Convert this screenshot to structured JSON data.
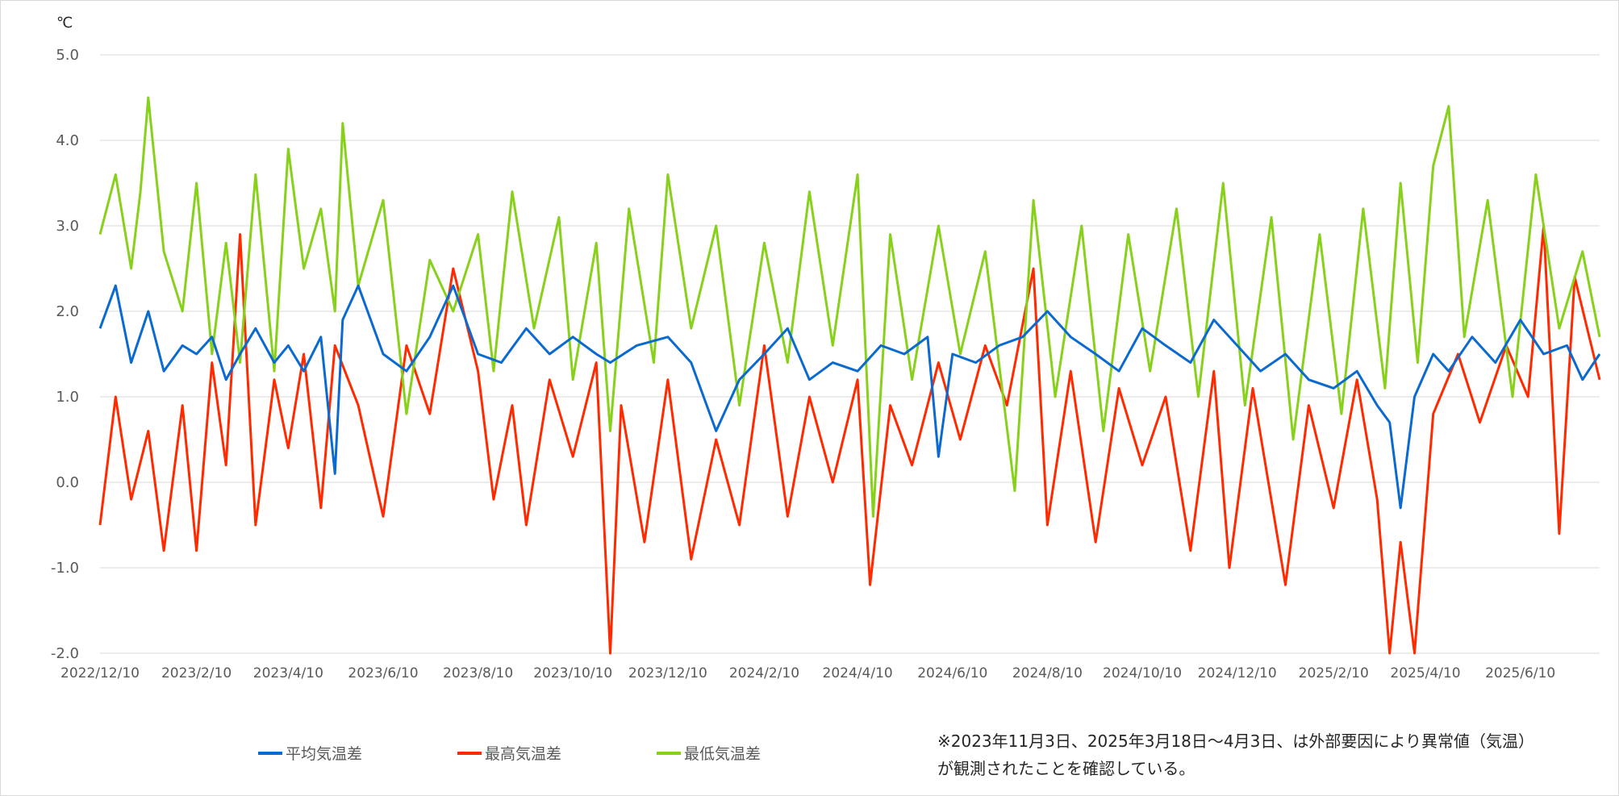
{
  "chart_data": {
    "type": "line",
    "title": "",
    "ylabel": "℃",
    "xlabel": "",
    "ylim": [
      -2.0,
      5.0
    ],
    "yticks": [
      "5.0",
      "4.0",
      "3.0",
      "2.0",
      "1.0",
      "0.0",
      "-1.0",
      "-2.0"
    ],
    "x_start": "2022/12/10",
    "x_end": "2025/7/31",
    "xticks": [
      "2022/12/10",
      "2023/2/10",
      "2023/4/10",
      "2023/6/10",
      "2023/8/10",
      "2023/10/10",
      "2023/12/10",
      "2024/2/10",
      "2024/4/10",
      "2024/6/10",
      "2024/8/10",
      "2024/10/10",
      "2024/12/10",
      "2025/2/10",
      "2025/4/10",
      "2025/6/10"
    ],
    "grid": true,
    "legend_position": "bottom",
    "colors": {
      "avg": "#0a6ad0",
      "max": "#ff2a00",
      "min": "#88d11a",
      "grid": "#d9d9d9"
    },
    "series": [
      {
        "key": "avg",
        "name": "平均気温差",
        "color": "#0a6ad0",
        "points": [
          [
            "2022/12/10",
            1.8
          ],
          [
            "2022/12/20",
            2.3
          ],
          [
            "2022/12/30",
            1.4
          ],
          [
            "2023/1/10",
            2.0
          ],
          [
            "2023/1/20",
            1.3
          ],
          [
            "2023/2/1",
            1.6
          ],
          [
            "2023/2/10",
            1.5
          ],
          [
            "2023/2/20",
            1.7
          ],
          [
            "2023/3/1",
            1.2
          ],
          [
            "2023/3/10",
            1.5
          ],
          [
            "2023/3/20",
            1.8
          ],
          [
            "2023/4/1",
            1.4
          ],
          [
            "2023/4/10",
            1.6
          ],
          [
            "2023/4/20",
            1.3
          ],
          [
            "2023/5/1",
            1.7
          ],
          [
            "2023/5/10",
            0.1
          ],
          [
            "2023/5/15",
            1.9
          ],
          [
            "2023/5/25",
            2.3
          ],
          [
            "2023/6/10",
            1.5
          ],
          [
            "2023/6/25",
            1.3
          ],
          [
            "2023/7/10",
            1.7
          ],
          [
            "2023/7/25",
            2.3
          ],
          [
            "2023/8/10",
            1.5
          ],
          [
            "2023/8/25",
            1.4
          ],
          [
            "2023/9/10",
            1.8
          ],
          [
            "2023/9/25",
            1.5
          ],
          [
            "2023/10/10",
            1.7
          ],
          [
            "2023/10/25",
            1.5
          ],
          [
            "2023/11/3",
            1.4
          ],
          [
            "2023/11/20",
            1.6
          ],
          [
            "2023/12/10",
            1.7
          ],
          [
            "2023/12/25",
            1.4
          ],
          [
            "2024/1/10",
            0.6
          ],
          [
            "2024/1/25",
            1.2
          ],
          [
            "2024/2/10",
            1.5
          ],
          [
            "2024/2/25",
            1.8
          ],
          [
            "2024/3/10",
            1.2
          ],
          [
            "2024/3/25",
            1.4
          ],
          [
            "2024/4/10",
            1.3
          ],
          [
            "2024/4/25",
            1.6
          ],
          [
            "2024/5/10",
            1.5
          ],
          [
            "2024/5/25",
            1.7
          ],
          [
            "2024/6/1",
            0.3
          ],
          [
            "2024/6/10",
            1.5
          ],
          [
            "2024/6/25",
            1.4
          ],
          [
            "2024/7/10",
            1.6
          ],
          [
            "2024/7/25",
            1.7
          ],
          [
            "2024/8/10",
            2.0
          ],
          [
            "2024/8/25",
            1.7
          ],
          [
            "2024/9/10",
            1.5
          ],
          [
            "2024/9/25",
            1.3
          ],
          [
            "2024/10/10",
            1.8
          ],
          [
            "2024/10/25",
            1.6
          ],
          [
            "2024/11/10",
            1.4
          ],
          [
            "2024/11/25",
            1.9
          ],
          [
            "2024/12/10",
            1.6
          ],
          [
            "2024/12/25",
            1.3
          ],
          [
            "2025/1/10",
            1.5
          ],
          [
            "2025/1/25",
            1.2
          ],
          [
            "2025/2/10",
            1.1
          ],
          [
            "2025/2/25",
            1.3
          ],
          [
            "2025/3/10",
            0.9
          ],
          [
            "2025/3/18",
            0.7
          ],
          [
            "2025/3/25",
            -0.3
          ],
          [
            "2025/4/3",
            1.0
          ],
          [
            "2025/4/15",
            1.5
          ],
          [
            "2025/4/25",
            1.3
          ],
          [
            "2025/5/10",
            1.7
          ],
          [
            "2025/5/25",
            1.4
          ],
          [
            "2025/6/10",
            1.9
          ],
          [
            "2025/6/25",
            1.5
          ],
          [
            "2025/7/10",
            1.6
          ],
          [
            "2025/7/20",
            1.2
          ],
          [
            "2025/7/31",
            1.5
          ]
        ]
      },
      {
        "key": "max",
        "name": "最高気温差",
        "color": "#ff2a00",
        "points": [
          [
            "2022/12/10",
            -0.5
          ],
          [
            "2022/12/20",
            1.0
          ],
          [
            "2022/12/30",
            -0.2
          ],
          [
            "2023/1/10",
            0.6
          ],
          [
            "2023/1/20",
            -0.8
          ],
          [
            "2023/2/1",
            0.9
          ],
          [
            "2023/2/10",
            -0.8
          ],
          [
            "2023/2/20",
            1.4
          ],
          [
            "2023/3/1",
            0.2
          ],
          [
            "2023/3/10",
            2.9
          ],
          [
            "2023/3/20",
            -0.5
          ],
          [
            "2023/4/1",
            1.2
          ],
          [
            "2023/4/10",
            0.4
          ],
          [
            "2023/4/20",
            1.5
          ],
          [
            "2023/5/1",
            -0.3
          ],
          [
            "2023/5/10",
            1.6
          ],
          [
            "2023/5/25",
            0.9
          ],
          [
            "2023/6/10",
            -0.4
          ],
          [
            "2023/6/25",
            1.6
          ],
          [
            "2023/7/10",
            0.8
          ],
          [
            "2023/7/25",
            2.5
          ],
          [
            "2023/8/10",
            1.3
          ],
          [
            "2023/8/20",
            -0.2
          ],
          [
            "2023/9/1",
            0.9
          ],
          [
            "2023/9/10",
            -0.5
          ],
          [
            "2023/9/25",
            1.2
          ],
          [
            "2023/10/10",
            0.3
          ],
          [
            "2023/10/25",
            1.4
          ],
          [
            "2023/11/3",
            -2.0
          ],
          [
            "2023/11/10",
            0.9
          ],
          [
            "2023/11/25",
            -0.7
          ],
          [
            "2023/12/10",
            1.2
          ],
          [
            "2023/12/25",
            -0.9
          ],
          [
            "2024/1/10",
            0.5
          ],
          [
            "2024/1/25",
            -0.5
          ],
          [
            "2024/2/10",
            1.6
          ],
          [
            "2024/2/25",
            -0.4
          ],
          [
            "2024/3/10",
            1.0
          ],
          [
            "2024/3/25",
            0.0
          ],
          [
            "2024/4/10",
            1.2
          ],
          [
            "2024/4/18",
            -1.2
          ],
          [
            "2024/5/1",
            0.9
          ],
          [
            "2024/5/15",
            0.2
          ],
          [
            "2024/6/1",
            1.4
          ],
          [
            "2024/6/15",
            0.5
          ],
          [
            "2024/7/1",
            1.6
          ],
          [
            "2024/7/15",
            0.9
          ],
          [
            "2024/8/1",
            2.5
          ],
          [
            "2024/8/10",
            -0.5
          ],
          [
            "2024/8/25",
            1.3
          ],
          [
            "2024/9/10",
            -0.7
          ],
          [
            "2024/9/25",
            1.1
          ],
          [
            "2024/10/10",
            0.2
          ],
          [
            "2024/10/25",
            1.0
          ],
          [
            "2024/11/10",
            -0.8
          ],
          [
            "2024/11/25",
            1.3
          ],
          [
            "2024/12/5",
            -1.0
          ],
          [
            "2024/12/20",
            1.1
          ],
          [
            "2025/1/10",
            -1.2
          ],
          [
            "2025/1/25",
            0.9
          ],
          [
            "2025/2/10",
            -0.3
          ],
          [
            "2025/2/25",
            1.2
          ],
          [
            "2025/3/10",
            -0.2
          ],
          [
            "2025/3/18",
            -2.0
          ],
          [
            "2025/3/25",
            -0.7
          ],
          [
            "2025/4/3",
            -2.0
          ],
          [
            "2025/4/15",
            0.8
          ],
          [
            "2025/5/1",
            1.5
          ],
          [
            "2025/5/15",
            0.7
          ],
          [
            "2025/6/1",
            1.6
          ],
          [
            "2025/6/15",
            1.0
          ],
          [
            "2025/6/25",
            3.0
          ],
          [
            "2025/7/5",
            -0.6
          ],
          [
            "2025/7/15",
            2.4
          ],
          [
            "2025/7/31",
            1.2
          ]
        ]
      },
      {
        "key": "min",
        "name": "最低気温差",
        "color": "#88d11a",
        "points": [
          [
            "2022/12/10",
            2.9
          ],
          [
            "2022/12/20",
            3.6
          ],
          [
            "2022/12/30",
            2.5
          ],
          [
            "2023/1/5",
            3.4
          ],
          [
            "2023/1/10",
            4.5
          ],
          [
            "2023/1/20",
            2.7
          ],
          [
            "2023/2/1",
            2.0
          ],
          [
            "2023/2/10",
            3.5
          ],
          [
            "2023/2/20",
            1.5
          ],
          [
            "2023/3/1",
            2.8
          ],
          [
            "2023/3/10",
            1.4
          ],
          [
            "2023/3/20",
            3.6
          ],
          [
            "2023/4/1",
            1.3
          ],
          [
            "2023/4/10",
            3.9
          ],
          [
            "2023/4/20",
            2.5
          ],
          [
            "2023/5/1",
            3.2
          ],
          [
            "2023/5/10",
            2.0
          ],
          [
            "2023/5/15",
            4.2
          ],
          [
            "2023/5/25",
            2.3
          ],
          [
            "2023/6/10",
            3.3
          ],
          [
            "2023/6/25",
            0.8
          ],
          [
            "2023/7/10",
            2.6
          ],
          [
            "2023/7/25",
            2.0
          ],
          [
            "2023/8/10",
            2.9
          ],
          [
            "2023/8/20",
            1.3
          ],
          [
            "2023/9/1",
            3.4
          ],
          [
            "2023/9/15",
            1.8
          ],
          [
            "2023/10/1",
            3.1
          ],
          [
            "2023/10/10",
            1.2
          ],
          [
            "2023/10/25",
            2.8
          ],
          [
            "2023/11/3",
            0.6
          ],
          [
            "2023/11/15",
            3.2
          ],
          [
            "2023/12/1",
            1.4
          ],
          [
            "2023/12/10",
            3.6
          ],
          [
            "2023/12/25",
            1.8
          ],
          [
            "2024/1/10",
            3.0
          ],
          [
            "2024/1/25",
            0.9
          ],
          [
            "2024/2/10",
            2.8
          ],
          [
            "2024/2/25",
            1.4
          ],
          [
            "2024/3/10",
            3.4
          ],
          [
            "2024/3/25",
            1.6
          ],
          [
            "2024/4/10",
            3.6
          ],
          [
            "2024/4/20",
            -0.4
          ],
          [
            "2024/5/1",
            2.9
          ],
          [
            "2024/5/15",
            1.2
          ],
          [
            "2024/6/1",
            3.0
          ],
          [
            "2024/6/15",
            1.5
          ],
          [
            "2024/7/1",
            2.7
          ],
          [
            "2024/7/20",
            -0.1
          ],
          [
            "2024/8/1",
            3.3
          ],
          [
            "2024/8/15",
            1.0
          ],
          [
            "2024/9/1",
            3.0
          ],
          [
            "2024/9/15",
            0.6
          ],
          [
            "2024/10/1",
            2.9
          ],
          [
            "2024/10/15",
            1.3
          ],
          [
            "2024/11/1",
            3.2
          ],
          [
            "2024/11/15",
            1.0
          ],
          [
            "2024/12/1",
            3.5
          ],
          [
            "2024/12/15",
            0.9
          ],
          [
            "2025/1/1",
            3.1
          ],
          [
            "2025/1/15",
            0.5
          ],
          [
            "2025/2/1",
            2.9
          ],
          [
            "2025/2/15",
            0.8
          ],
          [
            "2025/3/1",
            3.2
          ],
          [
            "2025/3/15",
            1.1
          ],
          [
            "2025/3/25",
            3.5
          ],
          [
            "2025/4/5",
            1.4
          ],
          [
            "2025/4/15",
            3.7
          ],
          [
            "2025/4/25",
            4.4
          ],
          [
            "2025/5/5",
            1.7
          ],
          [
            "2025/5/20",
            3.3
          ],
          [
            "2025/6/5",
            1.0
          ],
          [
            "2025/6/20",
            3.6
          ],
          [
            "2025/7/5",
            1.8
          ],
          [
            "2025/7/20",
            2.7
          ],
          [
            "2025/7/31",
            1.7
          ]
        ]
      }
    ]
  },
  "note": {
    "line1": "※2023年11月3日、2025年3月18日〜4月3日、は外部要因により異常値（気温）",
    "line2": "が観測されたことを確認している。"
  }
}
